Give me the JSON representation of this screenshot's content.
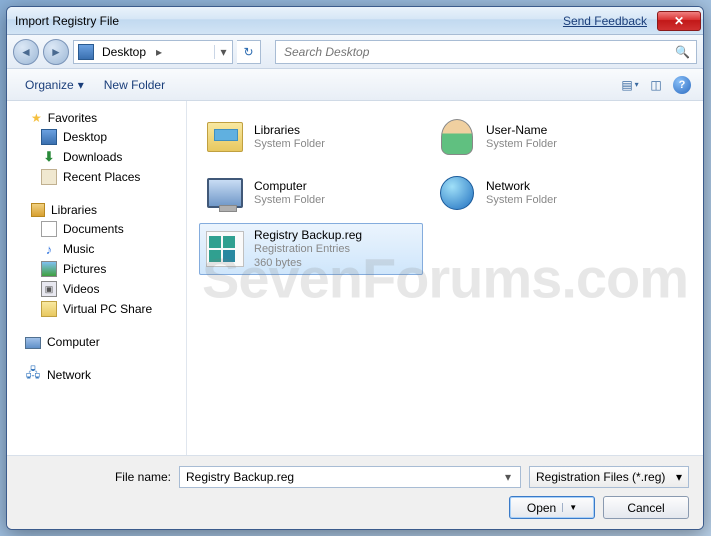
{
  "titlebar": {
    "title": "Import Registry File",
    "feedback": "Send Feedback"
  },
  "nav": {
    "location": "Desktop",
    "search_placeholder": "Search Desktop"
  },
  "toolbar": {
    "organize": "Organize",
    "newfolder": "New Folder"
  },
  "sidebar": {
    "favorites": {
      "label": "Favorites",
      "items": [
        "Desktop",
        "Downloads",
        "Recent Places"
      ]
    },
    "libraries": {
      "label": "Libraries",
      "items": [
        "Documents",
        "Music",
        "Pictures",
        "Videos",
        "Virtual PC Share"
      ]
    },
    "computer": "Computer",
    "network": "Network"
  },
  "content": {
    "items": [
      {
        "name": "Libraries",
        "sub1": "System Folder",
        "sub2": ""
      },
      {
        "name": "User-Name",
        "sub1": "System Folder",
        "sub2": ""
      },
      {
        "name": "Computer",
        "sub1": "System Folder",
        "sub2": ""
      },
      {
        "name": "Network",
        "sub1": "System Folder",
        "sub2": ""
      },
      {
        "name": "Registry Backup.reg",
        "sub1": "Registration Entries",
        "sub2": "360 bytes"
      }
    ]
  },
  "footer": {
    "filename_label": "File name:",
    "filename_value": "Registry Backup.reg",
    "filter": "Registration Files (*.reg)",
    "open": "Open",
    "cancel": "Cancel"
  },
  "watermark": "SevenForums.com"
}
